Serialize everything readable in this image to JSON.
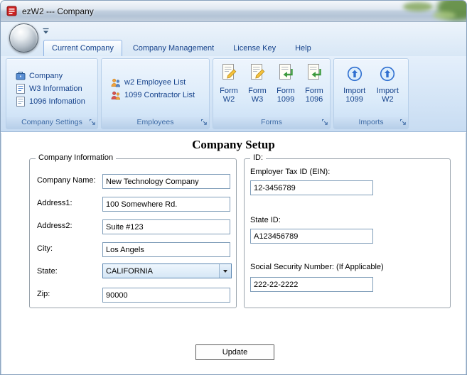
{
  "window": {
    "title": "ezW2 --- Company"
  },
  "tabs": [
    {
      "label": "Current Company"
    },
    {
      "label": "Company Management"
    },
    {
      "label": "License Key"
    },
    {
      "label": "Help"
    }
  ],
  "ribbon": {
    "groups": {
      "settings": {
        "label": "Company Settings",
        "items": [
          {
            "label": "Company"
          },
          {
            "label": "W3 Information"
          },
          {
            "label": "1096 Infomation"
          }
        ]
      },
      "employees": {
        "label": "Employees",
        "items": [
          {
            "label": "w2 Employee List"
          },
          {
            "label": "1099 Contractor List"
          }
        ]
      },
      "forms": {
        "label": "Forms",
        "items": [
          {
            "top": "Form",
            "bottom": "W2"
          },
          {
            "top": "Form",
            "bottom": "W3"
          },
          {
            "top": "Form",
            "bottom": "1099"
          },
          {
            "top": "Form",
            "bottom": "1096"
          }
        ]
      },
      "imports": {
        "label": "Imports",
        "items": [
          {
            "top": "Import",
            "bottom": "1099"
          },
          {
            "top": "Import",
            "bottom": "W2"
          }
        ]
      }
    }
  },
  "content": {
    "heading": "Company Setup",
    "company_info": {
      "legend": "Company Information",
      "fields": {
        "company_name": {
          "label": "Company Name:",
          "value": "New Technology Company"
        },
        "address1": {
          "label": "Address1:",
          "value": "100 Somewhere Rd."
        },
        "address2": {
          "label": "Address2:",
          "value": "Suite #123"
        },
        "city": {
          "label": "City:",
          "value": "Los Angels"
        },
        "state": {
          "label": "State:",
          "value": "CALIFORNIA"
        },
        "zip": {
          "label": "Zip:",
          "value": "90000"
        }
      }
    },
    "id_info": {
      "legend": "ID:",
      "fields": {
        "ein": {
          "label": "Employer Tax ID (EIN):",
          "value": "12-3456789"
        },
        "state_id": {
          "label": "State ID:",
          "value": "A123456789"
        },
        "ssn": {
          "label": "Social Security Number: (If Applicable)",
          "value": "222-22-2222"
        }
      }
    },
    "update_button": "Update"
  }
}
